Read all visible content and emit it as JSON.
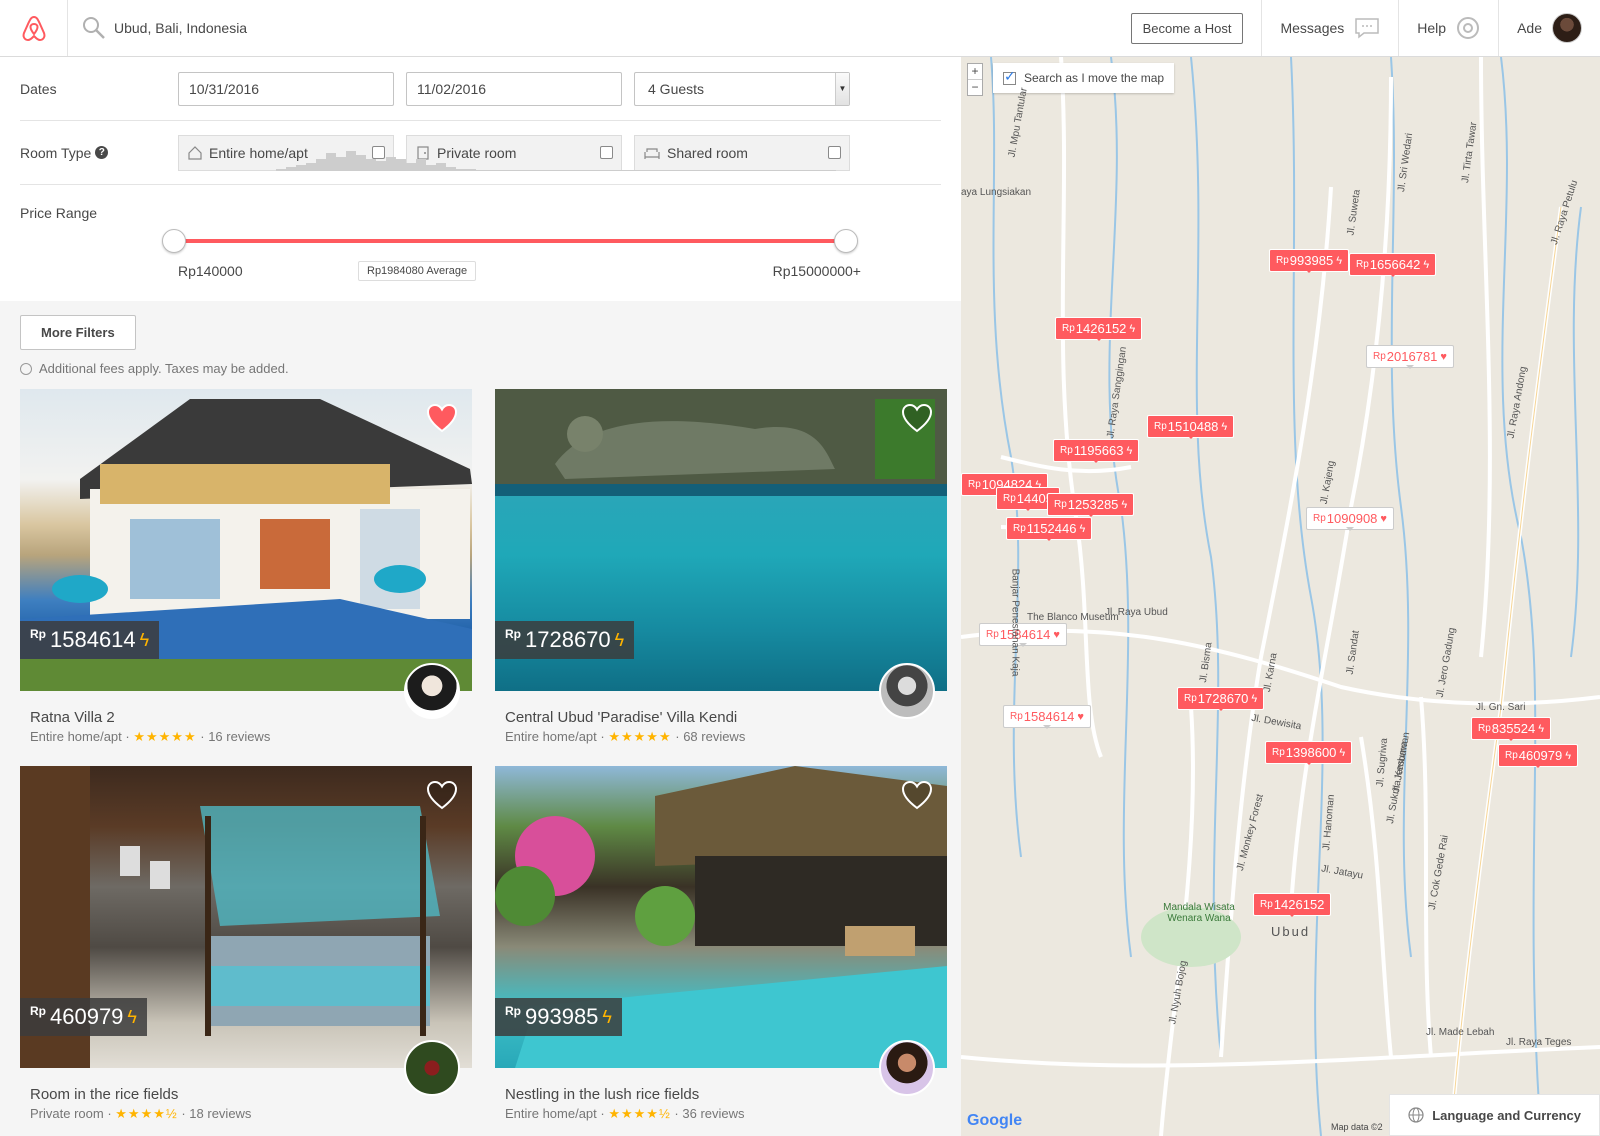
{
  "header": {
    "search_value": "Ubud, Bali, Indonesia",
    "become_host": "Become a Host",
    "messages": "Messages",
    "help": "Help",
    "user": "Ade"
  },
  "filters": {
    "dates_label": "Dates",
    "checkin": "10/31/2016",
    "checkout": "11/02/2016",
    "guests": "4 Guests",
    "room_type_label": "Room Type",
    "room_types": [
      "Entire home/apt",
      "Private room",
      "Shared room"
    ],
    "price_label": "Price Range",
    "price_min": "Rp140000",
    "price_max": "Rp15000000+",
    "price_avg": "Rp1984080 Average",
    "more_filters": "More Filters",
    "fees_note": "Additional fees apply. Taxes may be added."
  },
  "listings": [
    {
      "price": "1584614",
      "title": "Ratna Villa 2",
      "type": "Entire home/apt",
      "stars": "★★★★★",
      "reviews": "16 reviews",
      "favorited": true
    },
    {
      "price": "1728670",
      "title": "Central Ubud 'Paradise' Villa Kendi",
      "type": "Entire home/apt",
      "stars": "★★★★★",
      "reviews": "68 reviews",
      "favorited": false
    },
    {
      "price": "460979",
      "title": "Room in the rice fields",
      "type": "Private room",
      "stars": "★★★★½",
      "reviews": "18 reviews",
      "favorited": false
    },
    {
      "price": "993985",
      "title": "Nestling in the lush rice fields",
      "type": "Entire home/apt",
      "stars": "★★★★½",
      "reviews": "36 reviews",
      "favorited": false
    }
  ],
  "currency_prefix": "Rp",
  "map": {
    "search_as_move": "Search as I move the map",
    "zoom_in": "+",
    "zoom_out": "−",
    "language_currency": "Language and Currency",
    "map_data": "Map data ©2",
    "google": "Google",
    "pins": [
      {
        "label": "993985",
        "style": "red",
        "suffix": "ϟ"
      },
      {
        "label": "1656642",
        "style": "red",
        "suffix": "ϟ"
      },
      {
        "label": "1426152",
        "style": "red",
        "suffix": "ϟ"
      },
      {
        "label": "2016781",
        "style": "white",
        "suffix": "♥"
      },
      {
        "label": "1510488",
        "style": "red",
        "suffix": "ϟ"
      },
      {
        "label": "1195663",
        "style": "red",
        "suffix": "ϟ"
      },
      {
        "label": "1094824",
        "style": "red",
        "suffix": "ϟ"
      },
      {
        "label": "14405",
        "style": "red",
        "suffix": ""
      },
      {
        "label": "1253285",
        "style": "red",
        "suffix": "ϟ"
      },
      {
        "label": "1152446",
        "style": "red",
        "suffix": "ϟ"
      },
      {
        "label": "1090908",
        "style": "white",
        "suffix": "♥"
      },
      {
        "label": "1584614",
        "style": "white",
        "suffix": "♥"
      },
      {
        "label": "1584614",
        "style": "white",
        "suffix": "♥"
      },
      {
        "label": "1728670",
        "style": "red",
        "suffix": "ϟ"
      },
      {
        "label": "1398600",
        "style": "red",
        "suffix": "ϟ"
      },
      {
        "label": "835524",
        "style": "red",
        "suffix": "ϟ"
      },
      {
        "label": "460979",
        "style": "red",
        "suffix": "ϟ"
      },
      {
        "label": "1426152",
        "style": "red",
        "suffix": ""
      }
    ],
    "street_labels": [
      "Jl. Mpu Tantular",
      "aya Lungsiakan",
      "Jl. Raya Sanggingan",
      "Jl. Suweta",
      "Jl. Sri Wedari",
      "Jl. Tirta Tawar",
      "Jl. Raya Petulu",
      "Jl. Raya Andong",
      "Jl. Raya Ubud",
      "Jl. Kajeng",
      "Jl. Bisma",
      "Jl. Monkey Forest",
      "Jl. Hanoman",
      "Jl. Sugriwa",
      "Jl. Jembawan",
      "Jl. Dewisita",
      "Jl. Jatayu",
      "Jl. Nyuh Bojog",
      "Jl. Made Lebah",
      "Jl. Raya Teges",
      "Jl. Cok Gede Rai",
      "Jl. Sukma Kesuma",
      "Jl. Gn. Sari",
      "Ubud",
      "Mandala Wisata Wenara Wana",
      "The Blanco Museum",
      "Jl. Jero Gadung",
      "Jl. Sandat",
      "Jl. Karna",
      "Banjar Penestanan Kaja"
    ]
  }
}
